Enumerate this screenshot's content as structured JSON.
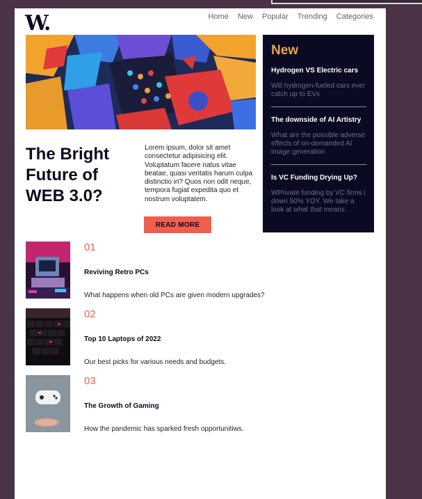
{
  "brand": {
    "logo": "W."
  },
  "nav": {
    "items": [
      "Home",
      "New",
      "Popular",
      "Trending",
      "Categories"
    ]
  },
  "featured": {
    "headline": "The Bright Future of WEB 3.0?",
    "body": "Lorem ipsum, dolor sit amet consectetur adipisicing elit. Voluptatum facere natus vitae beatae, quasi veritatis harum culpa distinctio in? Quos non odit neque, tempora fugiat expedita quo et nostrum voluptatem.",
    "button_label": "READ MORE"
  },
  "new_panel": {
    "title": "New",
    "items": [
      {
        "title": "Hydrogen VS Electric cars",
        "desc": "Will hydrogen-fueled cars ever catch up to EVs"
      },
      {
        "title": "The downside of AI Artistry",
        "desc": "What are the possible adverse effects of on-demanded AI image generation"
      },
      {
        "title": "Is VC Funding Drying Up?",
        "desc": "WPrivate funding by VC firms i down 50% YOY. We take a look at what that means."
      }
    ]
  },
  "articles": [
    {
      "number": "01",
      "title": "Reviving Retro PCs",
      "desc": "What happens when old PCs are given modern upgrades?"
    },
    {
      "number": "02",
      "title": "Top 10 Laptops of 2022",
      "desc": "Our best picks for various needs and budgets."
    },
    {
      "number": "03",
      "title": "The Growth of Gaming",
      "desc": "How the pandemic has sparked fresh opportunitiws."
    }
  ],
  "colors": {
    "accent": "#f05e4d",
    "new_title": "#e9a34c",
    "panel_bg": "#0a0b22",
    "outer_bg": "#4a3346"
  }
}
